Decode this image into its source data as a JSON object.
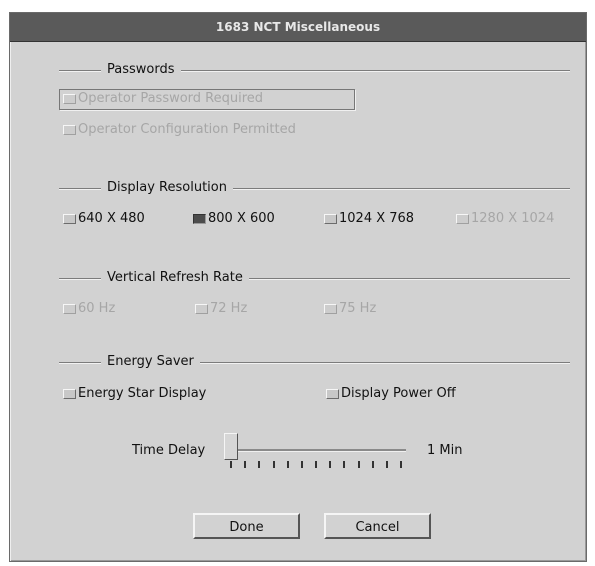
{
  "window": {
    "title": "1683 NCT Miscellaneous"
  },
  "passwords": {
    "title": "Passwords",
    "items": [
      {
        "label": "Operator Password Required",
        "checked": false,
        "enabled": false
      },
      {
        "label": "Operator Configuration Permitted",
        "checked": false,
        "enabled": false
      }
    ]
  },
  "display_resolution": {
    "title": "Display Resolution",
    "options": [
      {
        "label": "640 X 480",
        "selected": false,
        "enabled": true
      },
      {
        "label": "800 X 600",
        "selected": true,
        "enabled": true
      },
      {
        "label": "1024 X 768",
        "selected": false,
        "enabled": true
      },
      {
        "label": "1280 X 1024",
        "selected": false,
        "enabled": false
      }
    ]
  },
  "refresh_rate": {
    "title": "Vertical Refresh Rate",
    "options": [
      {
        "label": "60 Hz",
        "selected": false,
        "enabled": false
      },
      {
        "label": "72 Hz",
        "selected": false,
        "enabled": false
      },
      {
        "label": "75 Hz",
        "selected": false,
        "enabled": false
      }
    ]
  },
  "energy_saver": {
    "title": "Energy Saver",
    "energy_star": {
      "label": "Energy Star Display",
      "checked": false
    },
    "power_off": {
      "label": "Display Power Off",
      "checked": false
    },
    "time_delay": {
      "label": "Time Delay",
      "value_text": "1 Min",
      "position_fraction": 0.0,
      "tick_count": 13
    }
  },
  "buttons": {
    "done": "Done",
    "cancel": "Cancel"
  }
}
